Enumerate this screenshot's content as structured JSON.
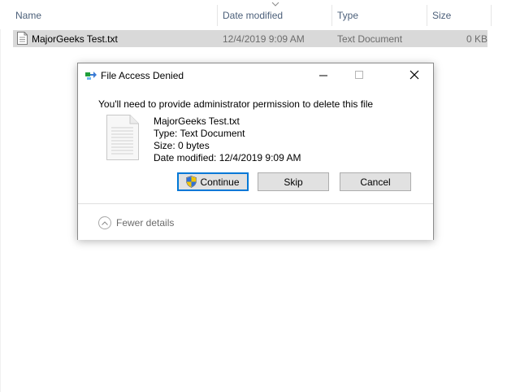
{
  "explorer": {
    "columns": {
      "name": "Name",
      "date_modified": "Date modified",
      "type": "Type",
      "size": "Size"
    },
    "rows": [
      {
        "name": "MajorGeeks Test.txt",
        "date_modified": "12/4/2019 9:09 AM",
        "type": "Text Document",
        "size": "0 KB"
      }
    ]
  },
  "dialog": {
    "title": "File Access Denied",
    "message": "You'll need to provide administrator permission to delete this file",
    "file": {
      "name": "MajorGeeks Test.txt",
      "type": "Type: Text Document",
      "size": "Size: 0 bytes",
      "date_modified": "Date modified: 12/4/2019 9:09 AM"
    },
    "buttons": {
      "continue": "Continue",
      "skip": "Skip",
      "cancel": "Cancel"
    },
    "fewer_details": "Fewer details"
  },
  "colors": {
    "accent": "#0078d7",
    "selected_row": "#d9d9d9",
    "header_text": "#4c607a"
  },
  "icons": {
    "dialog_title": "file-move-icon",
    "file": "text-document-icon",
    "continue": "uac-shield-icon",
    "fewer_details": "chevron-up-icon"
  }
}
